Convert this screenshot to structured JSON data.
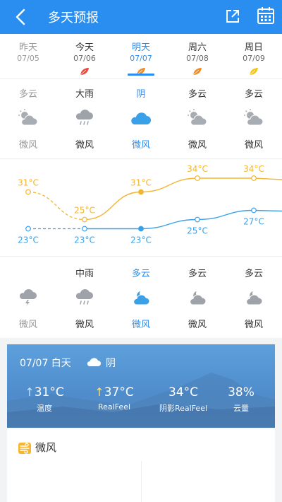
{
  "header": {
    "title": "多天预报"
  },
  "days": [
    {
      "label": "昨天",
      "date": "07/05",
      "day_cond": "多云",
      "day_wind": "微风",
      "night_cond": "",
      "night_wind": "微风",
      "high": "31°C",
      "low": "23°C",
      "leaf_color": "#ffffff",
      "state": "past"
    },
    {
      "label": "今天",
      "date": "07/06",
      "day_cond": "大雨",
      "day_wind": "微风",
      "night_cond": "中雨",
      "night_wind": "微风",
      "high": "25°C",
      "low": "23°C",
      "leaf_color": "#e8493a",
      "state": "normal"
    },
    {
      "label": "明天",
      "date": "07/07",
      "day_cond": "阴",
      "day_wind": "微风",
      "night_cond": "多云",
      "night_wind": "微风",
      "high": "31°C",
      "low": "23°C",
      "leaf_color": "#f08a24",
      "state": "sel"
    },
    {
      "label": "周六",
      "date": "07/08",
      "day_cond": "多云",
      "day_wind": "微风",
      "night_cond": "多云",
      "night_wind": "微风",
      "high": "34°C",
      "low": "25°C",
      "leaf_color": "#f08a24",
      "state": "normal"
    },
    {
      "label": "周日",
      "date": "07/09",
      "day_cond": "多云",
      "day_wind": "微风",
      "night_cond": "多云",
      "night_wind": "微风",
      "high": "34°C",
      "low": "27°C",
      "leaf_color": "#f3c417",
      "state": "normal"
    }
  ],
  "chart_data": {
    "type": "line",
    "categories": [
      "07/05",
      "07/06",
      "07/07",
      "07/08",
      "07/09"
    ],
    "series": [
      {
        "values": [
          31,
          25,
          31,
          34,
          34
        ],
        "color": "#f2b531"
      },
      {
        "values": [
          23,
          23,
          23,
          25,
          27
        ],
        "color": "#3aa0e8"
      }
    ],
    "ylim": [
      20,
      36
    ]
  },
  "detail": {
    "date": "07/07 白天",
    "cond": "阴",
    "stats": [
      {
        "value": "31°C",
        "label": "温度"
      },
      {
        "value": "37°C",
        "label": "RealFeel"
      },
      {
        "value": "34°C",
        "label": "阴影RealFeel"
      },
      {
        "value": "38%",
        "label": "云量"
      }
    ]
  },
  "wind": {
    "label": "微风"
  }
}
